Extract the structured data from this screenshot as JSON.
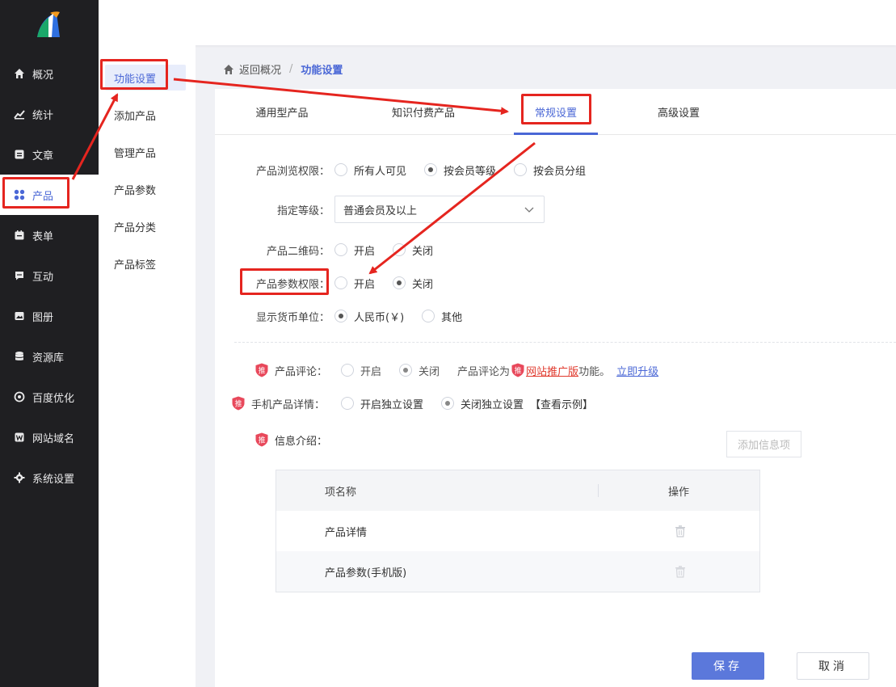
{
  "leftnav": {
    "items": [
      {
        "label": "概况",
        "icon": "home-icon"
      },
      {
        "label": "统计",
        "icon": "chart-icon"
      },
      {
        "label": "文章",
        "icon": "article-icon"
      },
      {
        "label": "产品",
        "icon": "grid-icon"
      },
      {
        "label": "表单",
        "icon": "form-icon"
      },
      {
        "label": "互动",
        "icon": "chat-icon"
      },
      {
        "label": "图册",
        "icon": "album-icon"
      },
      {
        "label": "资源库",
        "icon": "database-icon"
      },
      {
        "label": "百度优化",
        "icon": "target-icon"
      },
      {
        "label": "网站域名",
        "icon": "w-icon"
      },
      {
        "label": "系统设置",
        "icon": "gear-icon"
      }
    ],
    "active_index": 3
  },
  "subnav": {
    "items": [
      "功能设置",
      "添加产品",
      "管理产品",
      "产品参数",
      "产品分类",
      "产品标签"
    ],
    "active_index": 0
  },
  "breadcrumb": {
    "back": "返回概况",
    "separator": "/",
    "current": "功能设置"
  },
  "tabs": {
    "items": [
      "通用型产品",
      "知识付费产品",
      "常规设置",
      "高级设置"
    ],
    "active_index": 2
  },
  "form": {
    "browse": {
      "label": "产品浏览权限：",
      "options": [
        "所有人可见",
        "按会员等级",
        "按会员分组"
      ],
      "selected": 1
    },
    "level": {
      "label": "指定等级：",
      "value": "普通会员及以上"
    },
    "qrcode": {
      "label": "产品二维码：",
      "options": [
        "开启",
        "关闭"
      ],
      "selected": null
    },
    "param_perm": {
      "label": "产品参数权限：",
      "options": [
        "开启",
        "关闭"
      ],
      "selected": 1
    },
    "currency": {
      "label": "显示货币单位：",
      "options": [
        "人民币(￥)",
        "其他"
      ],
      "selected": 0
    },
    "review": {
      "label": "产品评论：",
      "options": [
        "开启",
        "关闭"
      ],
      "selected": 1,
      "note_prefix": "产品评论为",
      "badge": "推",
      "note_link": "网站推广版",
      "note_suffix": "功能。",
      "upgrade": "立即升级"
    },
    "mobile_detail": {
      "label": "手机产品详情：",
      "options": [
        "开启独立设置",
        "关闭独立设置"
      ],
      "selected": 1,
      "example": "【查看示例】"
    },
    "info": {
      "label": "信息介绍：",
      "add_button": "添加信息项"
    }
  },
  "table": {
    "headers": [
      "项名称",
      "操作"
    ],
    "rows": [
      {
        "name": "产品详情"
      },
      {
        "name": "产品参数(手机版)"
      }
    ]
  },
  "actions": {
    "save": "保存",
    "cancel": "取消"
  },
  "colors": {
    "accent": "#4a67d6",
    "annotation": "#e5251f",
    "nav_bg": "#1f1f22",
    "badge": "#e8485b"
  }
}
